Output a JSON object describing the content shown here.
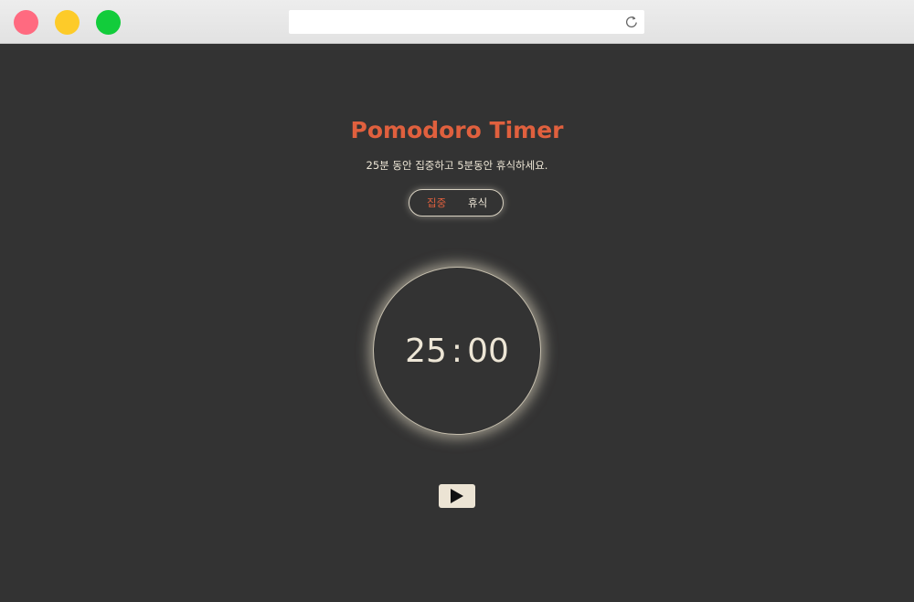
{
  "browser": {
    "url": "",
    "controls": [
      "close",
      "minimize",
      "maximize"
    ],
    "colors": {
      "close": "#ff6a80",
      "minimize": "#fdcb29",
      "maximize": "#12cc3b"
    },
    "reload_icon": "reload-icon"
  },
  "app": {
    "title": "Pomodoro Timer",
    "subtitle": "25분 동안 집중하고 5분동안 휴식하세요.",
    "modes": {
      "focus_label": "집중",
      "rest_label": "휴식",
      "active": "focus"
    },
    "timer": {
      "minutes": "25",
      "separator": ":",
      "seconds": "00"
    },
    "play_icon": "play-icon",
    "colors": {
      "background": "#333333",
      "accent": "#e0603e",
      "text": "#ede6d6",
      "button": "#ece4d4"
    }
  }
}
